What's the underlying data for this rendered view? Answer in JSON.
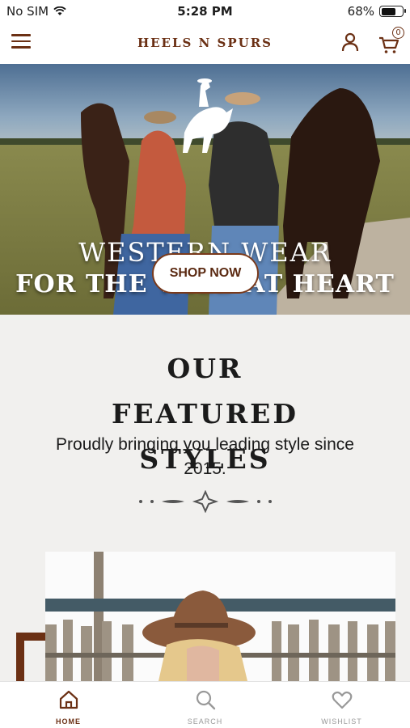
{
  "status_bar": {
    "carrier": "No SIM",
    "time": "5:28 PM",
    "battery_percent": "68%",
    "battery_level": 0.68,
    "wifi_icon": "wifi-icon"
  },
  "header": {
    "brand": "HEELS N SPURS",
    "menu_icon": "hamburger-menu-icon",
    "account_icon": "user-icon",
    "cart_icon": "cart-icon",
    "cart_count": "0"
  },
  "hero": {
    "title_line1": "WESTERN WEAR",
    "title_line2": "FOR THE WILD AT HEART",
    "cta_label": "SHOP NOW",
    "logo_icon": "bucking-horse-rider-icon"
  },
  "featured": {
    "title": "OUR FEATURED STYLES",
    "subtitle": "Proudly bringing you leading style since 2015.",
    "divider_icon": "ornamental-divider-icon"
  },
  "bottom_nav": {
    "items": [
      {
        "label": "HOME",
        "icon": "home-icon",
        "active": true
      },
      {
        "label": "SEARCH",
        "icon": "search-icon",
        "active": false
      },
      {
        "label": "WISHLIST",
        "icon": "heart-icon",
        "active": false
      }
    ]
  },
  "colors": {
    "brand_brown": "#6b3014",
    "background": "#f1f0ee"
  }
}
